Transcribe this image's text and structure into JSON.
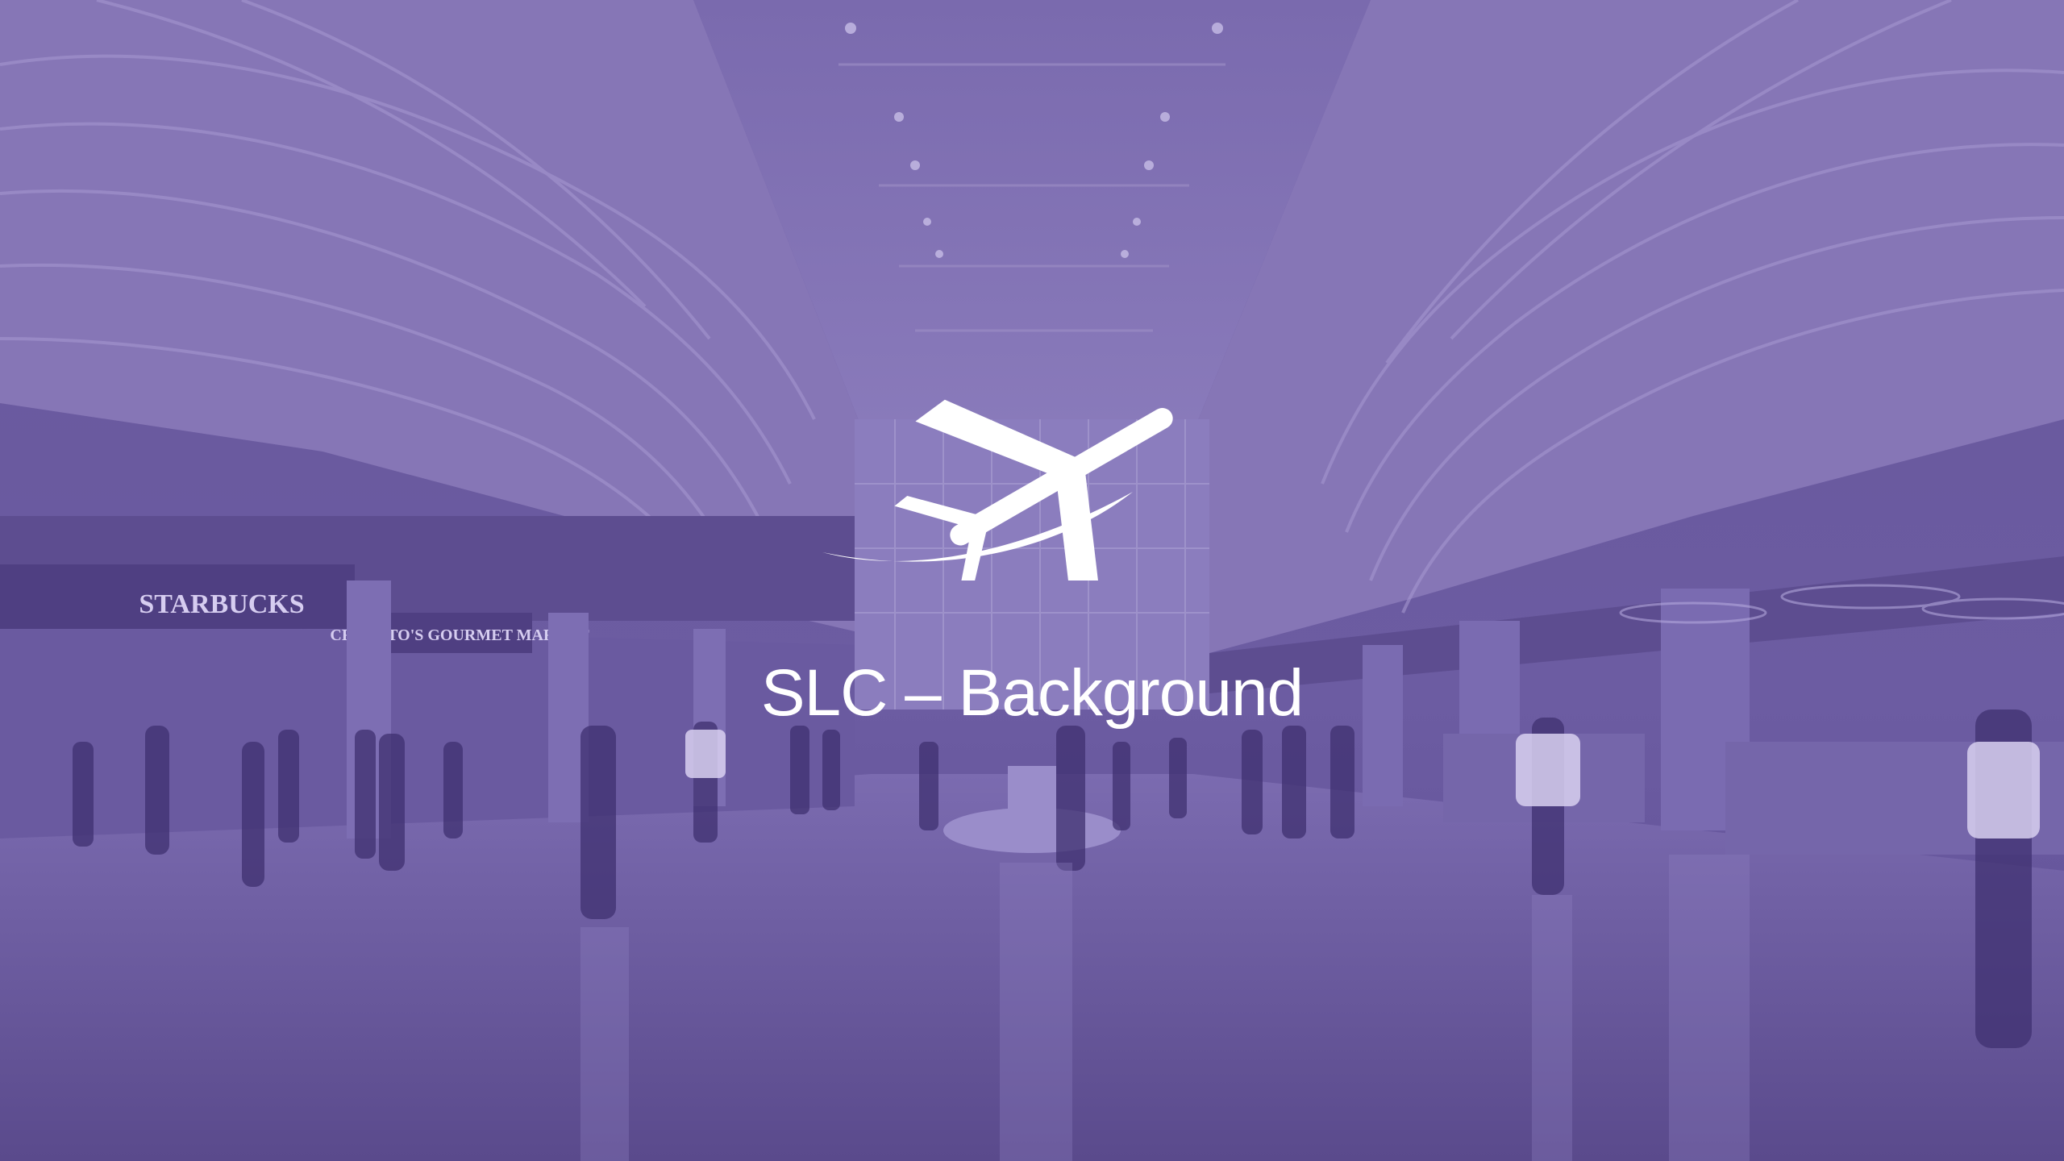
{
  "slide": {
    "title": "SLC – Background",
    "logo_icon": "airplane-swoosh-icon",
    "overlay_color": "#6b5a9e",
    "text_color": "#ffffff"
  },
  "background": {
    "signs": [
      "STARBUCKS",
      "CRANATO'S GOURMET MARKET"
    ]
  }
}
